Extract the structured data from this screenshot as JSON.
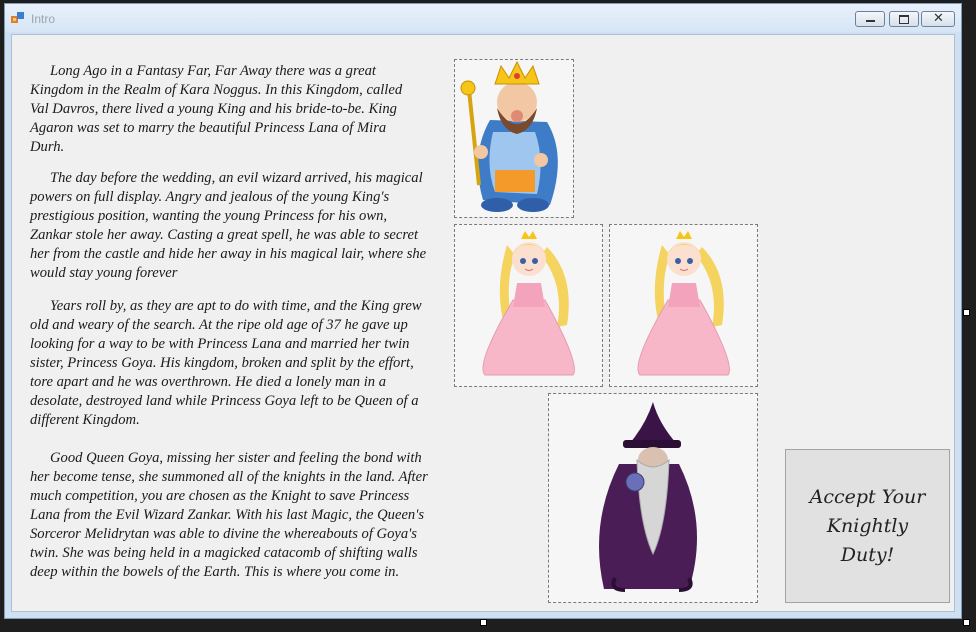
{
  "window": {
    "title": "Intro"
  },
  "story": {
    "p1": "Long Ago in a Fantasy Far, Far Away there was a great Kingdom in the Realm of Kara Noggus. In this Kingdom, called Val Davros, there lived a young King and his bride-to-be. King Agaron was set to marry the beautiful Princess Lana of Mira Durh.",
    "p2": "The day before the wedding, an evil wizard arrived, his magical powers on full display. Angry and jealous of the young King's prestigious position, wanting the young Princess for his own, Zankar stole her away. Casting a great spell, he was able to secret her from the castle and hide her away in his magical lair, where she would stay young forever",
    "p3": "Years roll by, as they are apt to do with time, and the King grew old and weary of the search. At the ripe old age of 37 he gave up looking for a way to be with Princess Lana and married her twin sister, Princess Goya. His kingdom, broken and split by the effort, tore apart and he was overthrown. He died a lonely man in a desolate, destroyed land while Princess Goya left to be Queen of a different Kingdom.",
    "p4": "Good Queen Goya, missing her sister and feeling the bond with her become tense, she summoned all of the knights in the land. After much competition, you are chosen as the Knight to save Princess Lana from the Evil Wizard Zankar. With his last Magic, the Queen's Sorceror Melidrytan was able to divine the whereabouts of Goya's twin. She was being held in a magicked catacomb of shifting walls deep within the bowels of the Earth. This is where you come in."
  },
  "accept_button": {
    "label": "Accept Your Knightly Duty!"
  },
  "colors": {
    "gold": "#f5c518",
    "king_blue": "#5b8fd6",
    "dress_pink": "#f7b7c9",
    "hair_yellow": "#f4d35e",
    "robe_purple": "#4b1d57"
  }
}
